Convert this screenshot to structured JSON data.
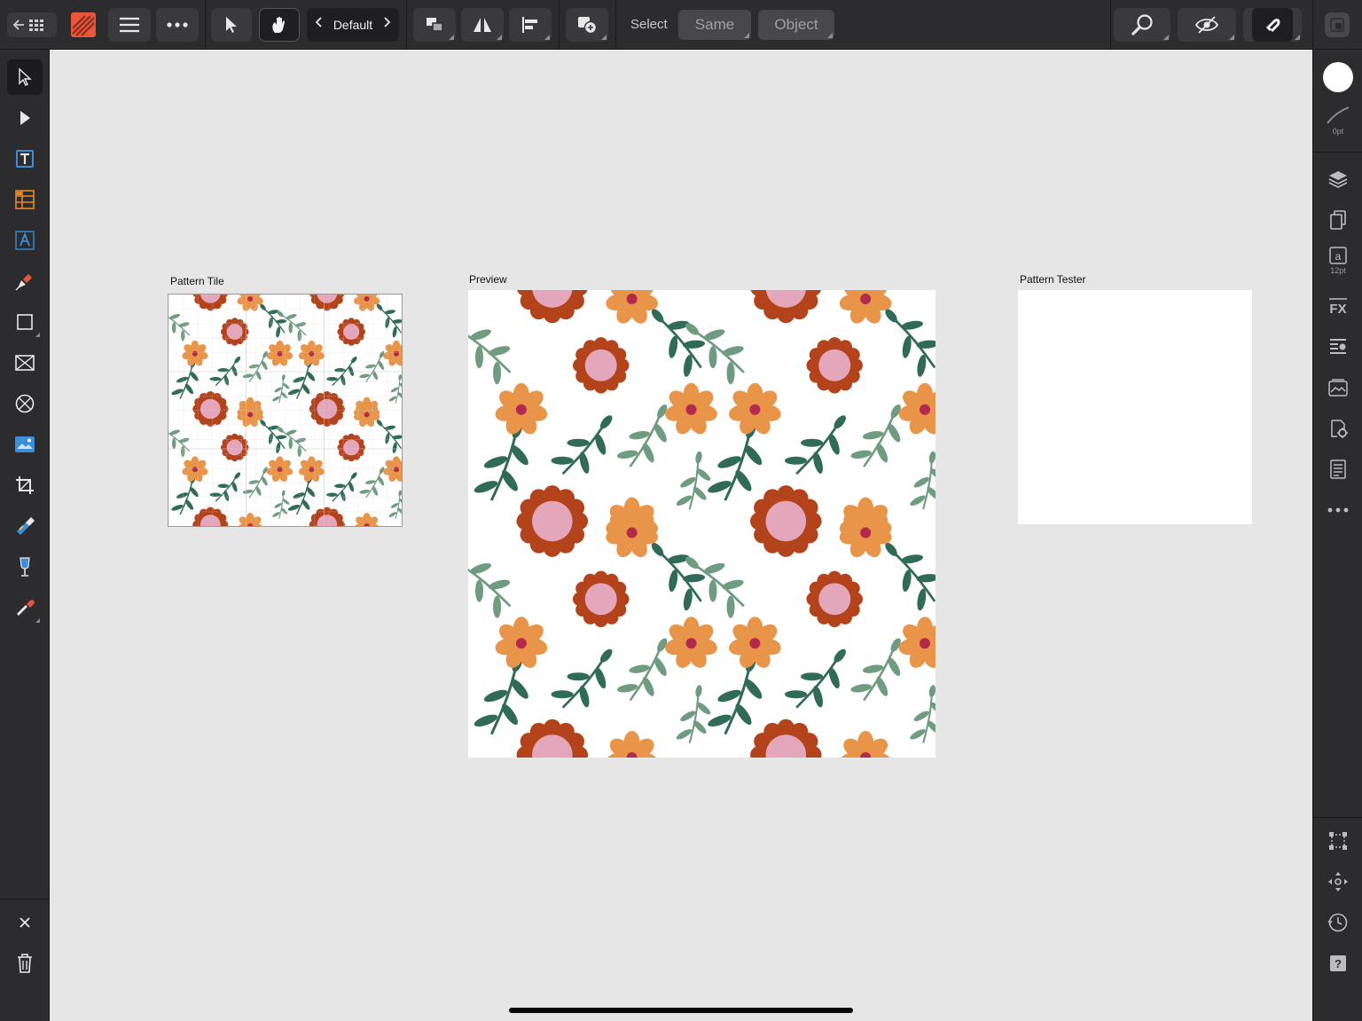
{
  "toolbar": {
    "persona_default": "Default",
    "select_label": "Select",
    "same_button": "Same",
    "object_button": "Object"
  },
  "canvas": {
    "tile_label": "Pattern Tile",
    "preview_label": "Preview",
    "tester_label": "Pattern Tester"
  },
  "studio": {
    "stroke_width": "0pt",
    "text_style_size": "12pt"
  },
  "colors": {
    "flower_orange": "#e8954a",
    "flower_rust": "#b3431a",
    "flower_center_pink": "#e3a6bb",
    "flower_dot_crimson": "#b22a4c",
    "leaf_dark": "#2f6b56",
    "leaf_light": "#6f9b80",
    "accent_app_icon": "#e8553a"
  },
  "icons": {
    "left_tools": [
      "move-tool-icon",
      "node-tool-icon",
      "text-frame-tool-icon",
      "table-tool-icon",
      "artistic-text-tool-icon",
      "pen-tool-icon",
      "rectangle-tool-icon",
      "picture-frame-tool-icon",
      "ellipse-frame-tool-icon",
      "place-image-tool-icon",
      "crop-tool-icon",
      "fill-tool-icon",
      "transparency-tool-icon",
      "color-picker-tool-icon"
    ],
    "right_studio": [
      "layers-icon",
      "pages-icon",
      "text-styles-icon",
      "fx-icon",
      "paragraph-icon",
      "stock-icon",
      "assets-icon",
      "document-icon",
      "more-icon",
      "transform-icon",
      "navigator-icon",
      "history-icon",
      "help-icon"
    ]
  }
}
